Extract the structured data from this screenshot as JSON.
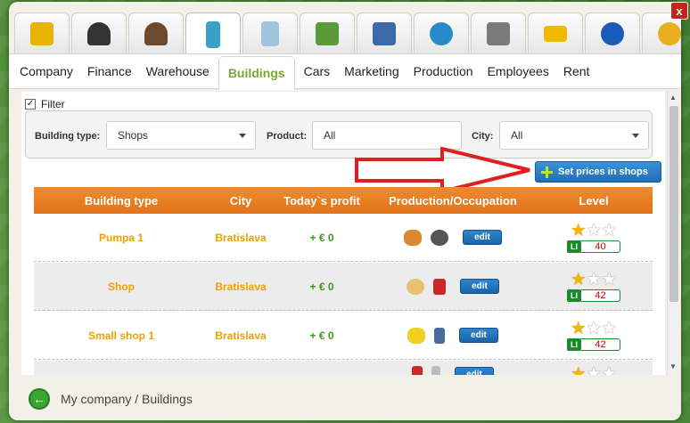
{
  "window": {
    "close_label": "x"
  },
  "icon_tabs": [
    {
      "name": "bulldozer-icon",
      "color": "#e8b400",
      "active": false
    },
    {
      "name": "businessman-icon",
      "color": "#333333",
      "active": false
    },
    {
      "name": "people-icon",
      "color": "#6b4a2e",
      "active": false
    },
    {
      "name": "building-icon",
      "color": "#3aa0c8",
      "active": true
    },
    {
      "name": "buildings-icon",
      "color": "#9fc4dc",
      "active": false
    },
    {
      "name": "money-building-icon",
      "color": "#5a9a3a",
      "active": false
    },
    {
      "name": "map-icon",
      "color": "#3a6aa8",
      "active": false
    },
    {
      "name": "globe-icon",
      "color": "#2a8ac8",
      "active": false
    },
    {
      "name": "tools-icon",
      "color": "#7a7a7a",
      "active": false
    },
    {
      "name": "mail-icon",
      "color": "#f0b800",
      "active": false
    },
    {
      "name": "info-icon",
      "color": "#1a5ab8",
      "active": false
    },
    {
      "name": "coin-icon",
      "color": "#e8b020",
      "active": false
    }
  ],
  "tabs": [
    "Company",
    "Finance",
    "Warehouse",
    "Buildings",
    "Cars",
    "Marketing",
    "Production",
    "Employees",
    "Rent"
  ],
  "filter": {
    "checkbox_label": "Filter",
    "building_type_label": "Building type:",
    "building_type_value": "Shops",
    "product_label": "Product:",
    "product_value": "All",
    "city_label": "City:",
    "city_value": "All"
  },
  "set_prices_label": "Set prices in shops",
  "table": {
    "headers": [
      "Building type",
      "City",
      "Today`s profit",
      "Production/Occupation",
      "Level"
    ],
    "rows": [
      {
        "type": "Pumpa 1",
        "city": "Bratislava",
        "profit": "+ € 0",
        "icons": [
          "bread-icon",
          "coffee-machine-icon"
        ],
        "edit": "edit",
        "stars": 1,
        "badge": "LI",
        "level": "40"
      },
      {
        "type": "Shop",
        "city": "Bratislava",
        "profit": "+ € 0",
        "icons": [
          "beer-icon",
          "chair-icon"
        ],
        "edit": "edit",
        "stars": 1,
        "badge": "LI",
        "level": "42"
      },
      {
        "type": "Small shop 1",
        "city": "Bratislava",
        "profit": "+ € 0",
        "icons": [
          "bananas-icon",
          "phone-icon"
        ],
        "edit": "edit",
        "stars": 1,
        "badge": "LI",
        "level": "42"
      },
      {
        "type": "",
        "city": "",
        "profit": "",
        "icons": [
          "chair-icon",
          "phone-icon"
        ],
        "edit": "edit",
        "stars": 1,
        "badge": "",
        "level": ""
      }
    ]
  },
  "footer": {
    "breadcrumb": "My company / Buildings"
  }
}
